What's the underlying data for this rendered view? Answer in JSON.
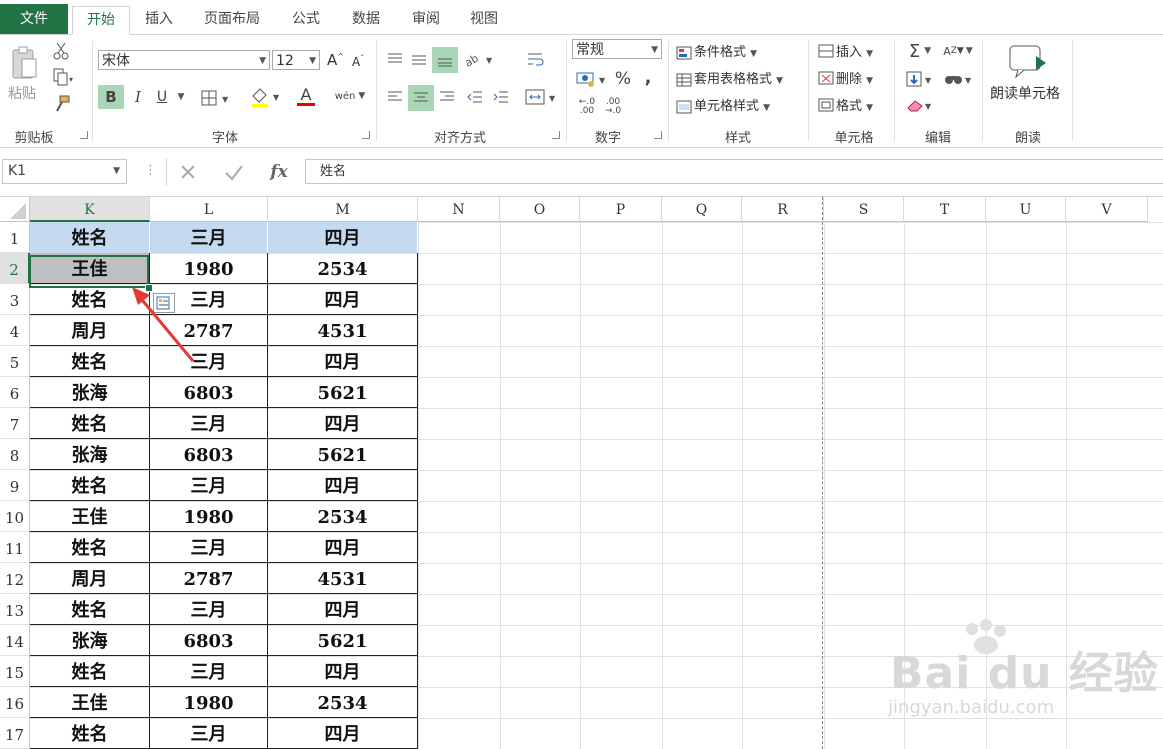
{
  "tabs": [
    "文件",
    "开始",
    "插入",
    "页面布局",
    "公式",
    "数据",
    "审阅",
    "视图"
  ],
  "active_tab": "开始",
  "ribbon": {
    "clipboard": {
      "paste_label": "粘贴",
      "group_label": "剪贴板"
    },
    "font": {
      "font_name": "宋体",
      "font_size": "12",
      "bold": "B",
      "italic": "I",
      "underline": "U",
      "font_color_glyph": "A",
      "phonetic_glyph": "wén",
      "group_label": "字体",
      "grow_glyph": "A",
      "shrink_glyph": "A"
    },
    "alignment": {
      "group_label": "对齐方式"
    },
    "number": {
      "format": "常规",
      "percent": "%",
      "comma": ",",
      "inc_decimal": ".00",
      "dec_decimal": ".00",
      "group_label": "数字"
    },
    "styles": {
      "conditional": "条件格式",
      "table": "套用表格格式",
      "cell_styles": "单元格样式",
      "group_label": "样式"
    },
    "cells": {
      "insert": "插入",
      "delete": "删除",
      "format": "格式",
      "group_label": "单元格"
    },
    "editing": {
      "sigma": "Σ",
      "sort_glyph": "A",
      "group_label": "编辑"
    },
    "read": {
      "label": "朗读单元格",
      "group_label": "朗读"
    }
  },
  "formula_bar": {
    "name_box": "K1",
    "fx": "fx",
    "content": "姓名"
  },
  "columns": [
    "K",
    "L",
    "M",
    "N",
    "O",
    "P",
    "Q",
    "R",
    "S",
    "T",
    "U",
    "V"
  ],
  "selected_column": "K",
  "rows": [
    "1",
    "2",
    "3",
    "4",
    "5",
    "6",
    "7",
    "8",
    "9",
    "10",
    "11",
    "12",
    "13",
    "14",
    "15",
    "16",
    "17"
  ],
  "selected_row": "2",
  "table": [
    [
      "姓名",
      "三月",
      "四月"
    ],
    [
      "王佳",
      "1980",
      "2534"
    ],
    [
      "姓名",
      "三月",
      "四月"
    ],
    [
      "周月",
      "2787",
      "4531"
    ],
    [
      "姓名",
      "三月",
      "四月"
    ],
    [
      "张海",
      "6803",
      "5621"
    ],
    [
      "姓名",
      "三月",
      "四月"
    ],
    [
      "张海",
      "6803",
      "5621"
    ],
    [
      "姓名",
      "三月",
      "四月"
    ],
    [
      "王佳",
      "1980",
      "2534"
    ],
    [
      "姓名",
      "三月",
      "四月"
    ],
    [
      "周月",
      "2787",
      "4531"
    ],
    [
      "姓名",
      "三月",
      "四月"
    ],
    [
      "张海",
      "6803",
      "5621"
    ],
    [
      "姓名",
      "三月",
      "四月"
    ],
    [
      "王佳",
      "1980",
      "2534"
    ],
    [
      "姓名",
      "三月",
      "四月"
    ]
  ],
  "watermark": {
    "brand": "Bai du 经验",
    "url": "jingyan.baidu.com"
  },
  "colors": {
    "accent": "#217346",
    "header_fill": "#c5d9f1",
    "selected_fill": "#bfbfbf",
    "arrow": "#e53935"
  }
}
